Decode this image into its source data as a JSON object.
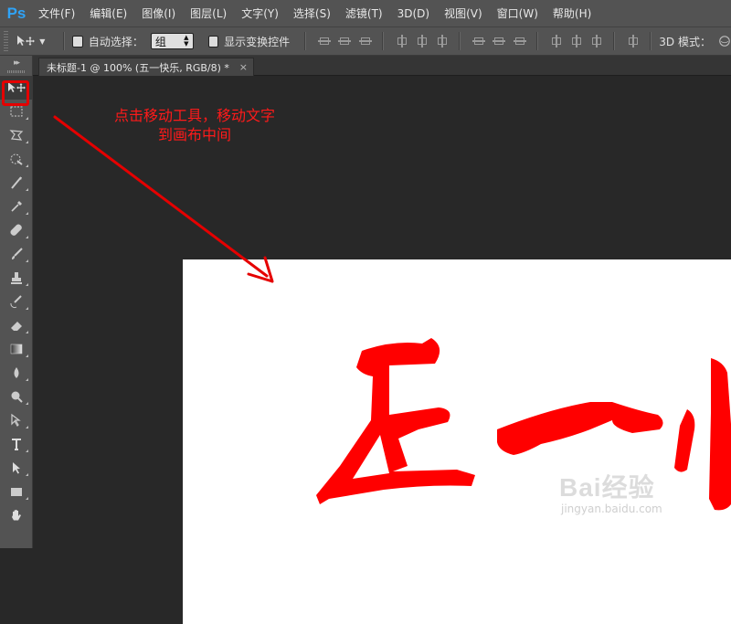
{
  "app": {
    "logo": "Ps"
  },
  "menu": {
    "items": [
      "文件(F)",
      "编辑(E)",
      "图像(I)",
      "图层(L)",
      "文字(Y)",
      "选择(S)",
      "滤镜(T)",
      "3D(D)",
      "视图(V)",
      "窗口(W)",
      "帮助(H)"
    ]
  },
  "options": {
    "auto_select_label": "自动选择：",
    "auto_select_value": "组",
    "show_transform_label": "显示变换控件",
    "mode_label": "3D 模式："
  },
  "document": {
    "tab_title": "未标题-1 @ 100% (五一快乐, RGB/8) *",
    "tab_close": "×",
    "canvas_text": "五一快"
  },
  "annotation": {
    "line1": "点击移动工具，移动文字",
    "line2": "到画布中间",
    "color": "#e50000"
  },
  "watermark": {
    "brand": "Bai经验",
    "url": "jingyan.baidu.com"
  },
  "icons": {
    "tools": [
      "move-icon",
      "marquee-icon",
      "lasso-icon",
      "quick-select-icon",
      "crop-icon",
      "eyedropper-icon",
      "healing-icon",
      "brush-icon",
      "stamp-icon",
      "history-brush-icon",
      "eraser-icon",
      "gradient-icon",
      "blur-icon",
      "dodge-icon",
      "pen-icon",
      "type-icon",
      "path-select-icon",
      "rectangle-icon",
      "hand-icon"
    ]
  }
}
